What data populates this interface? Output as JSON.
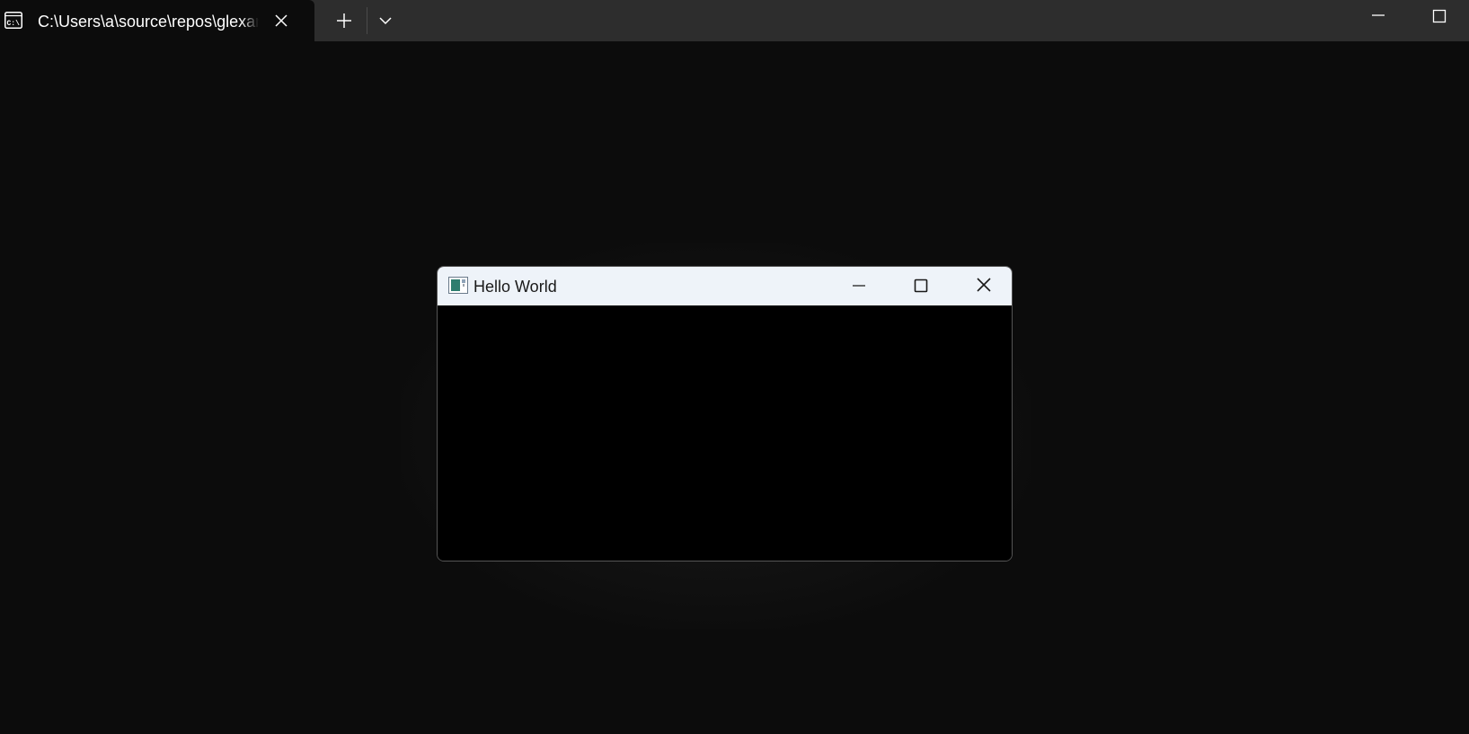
{
  "terminal": {
    "tab": {
      "title": "C:\\Users\\a\\source\\repos\\glexample",
      "icon": "command-prompt-icon"
    },
    "tab_close_icon": "close-icon",
    "new_tab_icon": "plus-icon",
    "dropdown_icon": "chevron-down-icon",
    "window_controls": {
      "minimize_icon": "minimize-icon",
      "maximize_icon": "maximize-icon"
    },
    "background_color": "#0c0c0c",
    "tabstrip_color": "#2d2d2d"
  },
  "hello_window": {
    "title": "Hello World",
    "icon": "app-window-icon",
    "titlebar_color": "#eef3f9",
    "client_color": "#000000",
    "controls": {
      "minimize_icon": "minimize-icon",
      "maximize_icon": "maximize-icon",
      "close_icon": "close-icon"
    }
  }
}
